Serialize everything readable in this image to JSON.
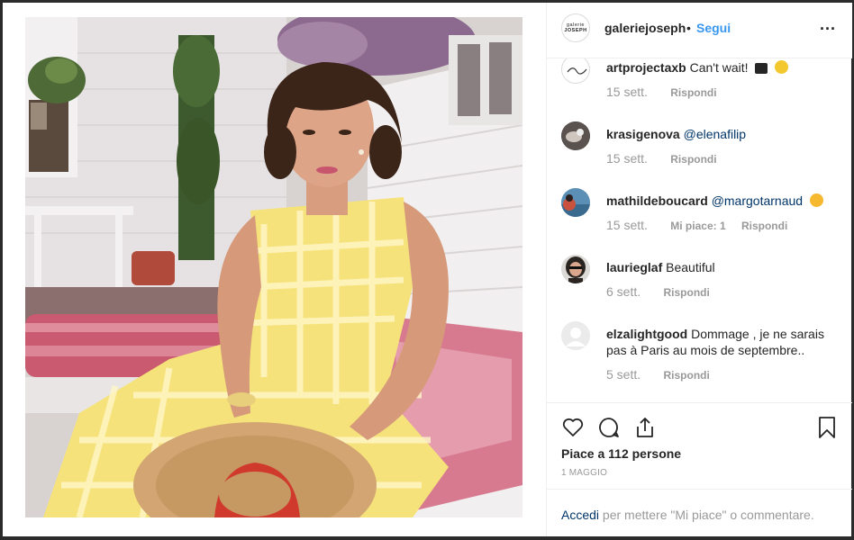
{
  "post": {
    "image_alt_semantic": "photo"
  },
  "header": {
    "logo_line1": "galerie",
    "logo_line2": "JOSEPH",
    "username": "galeriejoseph",
    "separator": "•",
    "follow_label": "Segui",
    "more_label": "..."
  },
  "comments": [
    {
      "user": "artprojectaxb",
      "text": "Can't wait!",
      "age": "15 sett.",
      "reply": "Rispondi",
      "likes": "",
      "emoji": "heart-emoji"
    },
    {
      "user": "krasigenova",
      "mention": "@elenafilip",
      "text": "",
      "age": "15 sett.",
      "reply": "Rispondi",
      "likes": ""
    },
    {
      "user": "mathildeboucard",
      "mention": "@margotarnaud",
      "text": "",
      "age": "15 sett.",
      "likes": "Mi piace: 1",
      "reply": "Rispondi",
      "emoji": "star-eyes-emoji"
    },
    {
      "user": "laurieglaf",
      "text": "Beautiful",
      "age": "6 sett.",
      "reply": "Rispondi",
      "likes": ""
    },
    {
      "user": "elzalightgood",
      "text": "Dommage , je ne sarais pas à Paris au mois de septembre..",
      "age": "5 sett.",
      "reply": "Rispondi",
      "likes": ""
    }
  ],
  "actions": {
    "likes_text": "Piace a 112 persone",
    "date": "1 MAGGIO"
  },
  "footer": {
    "login_link": "Accedi",
    "rest": " per mettere \"Mi piace\" o commentare."
  },
  "colors": {
    "link_blue": "#3897f0",
    "mention_blue": "#003569",
    "muted": "#999999",
    "text": "#262626",
    "border": "#efefef"
  }
}
